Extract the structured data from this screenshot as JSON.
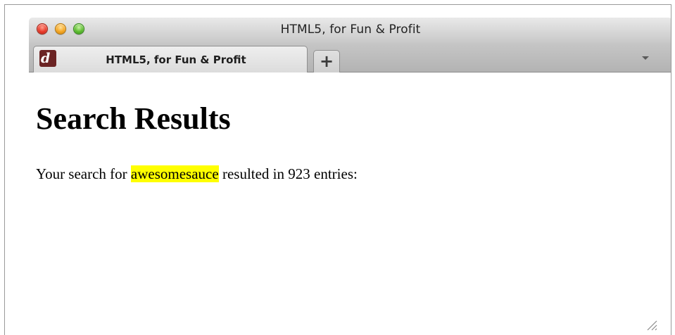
{
  "window": {
    "title": "HTML5, for Fun & Profit"
  },
  "tabs": [
    {
      "label": "HTML5, for Fun & Profit",
      "favicon": "di-favicon-icon",
      "active": true
    }
  ],
  "tabbar": {
    "new_tab_label": "+",
    "menu_icon": "chevron-down-icon"
  },
  "page": {
    "heading": "Search Results",
    "result_prefix": "Your search for",
    "search_term": "awesomesauce",
    "result_suffix": "resulted in 923 entries:"
  },
  "colors": {
    "highlight": "#ffff00",
    "close_button": "#e83a2a",
    "minimize_button": "#f5a623",
    "zoom_button": "#5cbc2f"
  }
}
